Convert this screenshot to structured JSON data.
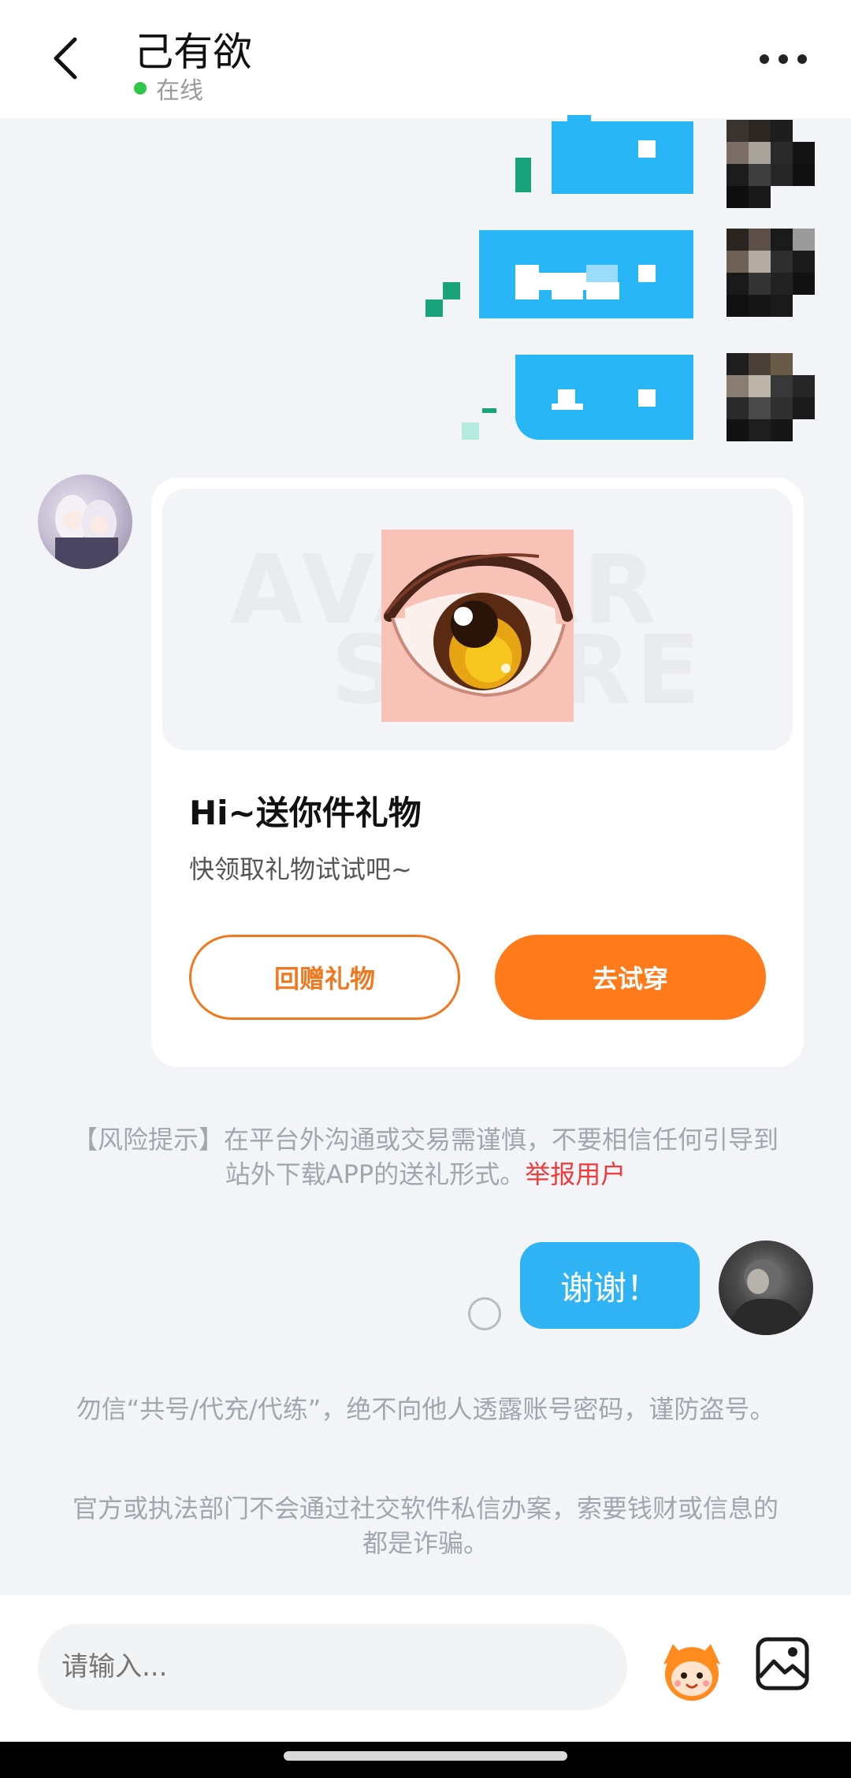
{
  "header": {
    "title": "己有欲",
    "status": "在线",
    "status_color": "#2fc84b"
  },
  "gift_card": {
    "title": "Hi~送你件礼物",
    "subtitle": "快领取礼物试试吧~",
    "return_gift_label": "回赠礼物",
    "try_on_label": "去试穿",
    "accent_color": "#ff7a1a"
  },
  "risk_notice": {
    "text": "【风险提示】在平台外沟通或交易需谨慎，不要相信任何引导到站外下载APP的送礼形式。",
    "report_link": "举报用户"
  },
  "outgoing_message": {
    "text": "谢谢！",
    "bubble_color": "#2fb3f5"
  },
  "system_notes": [
    "勿信“共号/代充/代练”，绝不向他人透露账号密码，谨防盗号。",
    "官方或执法部门不会通过社交软件私信办案，索要钱财或信息的都是诈骗。"
  ],
  "input": {
    "placeholder": "请输入..."
  },
  "icons": {
    "back": "chevron-left-icon",
    "more": "more-dots-icon",
    "sticker": "sticker-mascot-icon",
    "image": "image-icon"
  }
}
